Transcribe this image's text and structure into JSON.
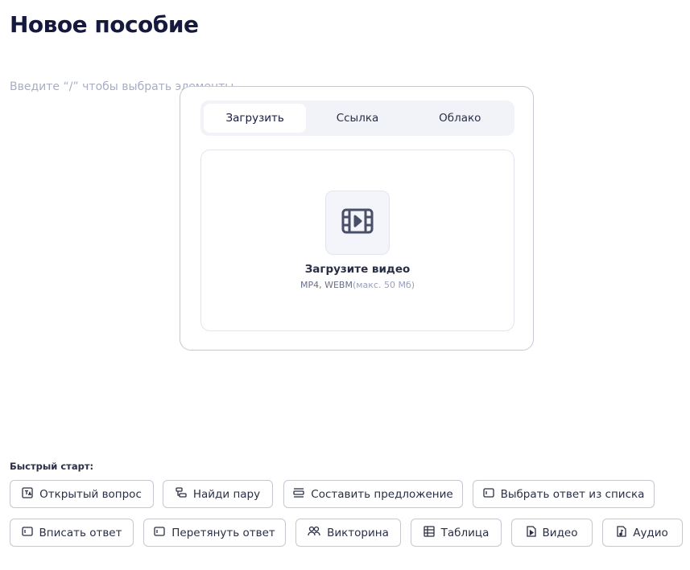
{
  "page": {
    "title": "Новое пособие",
    "editor_placeholder": "Введите “/” чтобы выбрать элементы"
  },
  "upload_modal": {
    "tabs": [
      {
        "label": "Загрузить",
        "active": true
      },
      {
        "label": "Ссылка",
        "active": false
      },
      {
        "label": "Облако",
        "active": false
      }
    ],
    "dropzone": {
      "icon": "film-play-icon",
      "title": "Загрузите видео",
      "formats": "MP4, WEBM",
      "limit": "(макс. 50 Мб)"
    }
  },
  "quick_start": {
    "label": "Быстрый старт:",
    "items": [
      {
        "label": "Открытый вопрос",
        "icon": "open-question-icon"
      },
      {
        "label": "Найди пару",
        "icon": "find-pair-icon"
      },
      {
        "label": "Составить предложение",
        "icon": "compose-sentence-icon"
      },
      {
        "label": "Выбрать ответ из списка",
        "icon": "select-list-icon"
      },
      {
        "label": "Вписать ответ",
        "icon": "input-answer-icon"
      },
      {
        "label": "Перетянуть ответ",
        "icon": "drag-answer-icon"
      },
      {
        "label": "Викторина",
        "icon": "quiz-icon"
      },
      {
        "label": "Таблица",
        "icon": "table-icon"
      },
      {
        "label": "Видео",
        "icon": "video-file-icon"
      },
      {
        "label": "Аудио",
        "icon": "audio-file-icon"
      }
    ]
  },
  "colors": {
    "title": "#14193d",
    "placeholder": "#a7adc6",
    "border": "#c5c8d3",
    "tab_bg": "#f2f3f8",
    "icon": "#4a4e66"
  }
}
